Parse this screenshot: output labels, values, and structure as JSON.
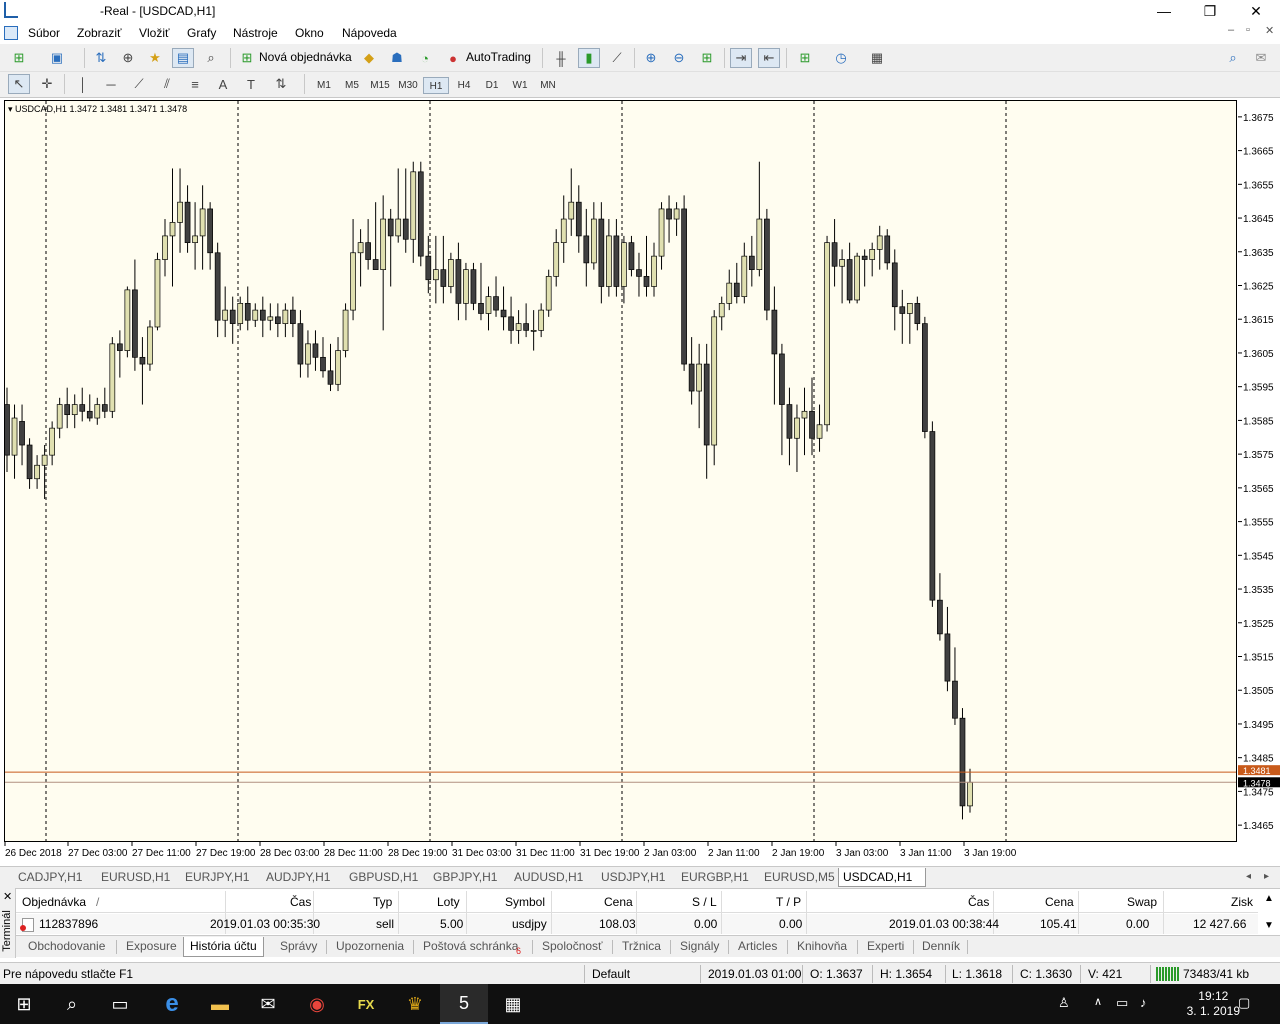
{
  "window": {
    "title": "-Real - [USDCAD,H1]",
    "minimize": "—",
    "maximize": "❐",
    "close": "✕"
  },
  "menu": [
    "Súbor",
    "Zobraziť",
    "Vložiť",
    "Grafy",
    "Nástroje",
    "Okno",
    "Nápoveda"
  ],
  "mdi": {
    "min": "–",
    "restore": "▫",
    "close": "✕"
  },
  "toolbar": {
    "new_order": "Nová objednávka",
    "autotrading": "AutoTrading"
  },
  "timeframes": [
    "M1",
    "M5",
    "M15",
    "M30",
    "H1",
    "H4",
    "D1",
    "W1",
    "MN"
  ],
  "active_timeframe": "H1",
  "chart": {
    "label": "USDCAD,H1  1.3472 1.3481 1.3471 1.3478",
    "bid_tag": "1.3481",
    "last_tag": "1.3478",
    "bg": "#fffdf0",
    "bull_color": "#e0e0b0",
    "bear_color": "#404040"
  },
  "chart_data": {
    "type": "candlestick",
    "symbol": "USDCAD",
    "timeframe": "H1",
    "ylim": [
      1.346,
      1.368
    ],
    "y_ticks": [
      "1.3675",
      "1.3665",
      "1.3655",
      "1.3645",
      "1.3635",
      "1.3625",
      "1.3615",
      "1.3605",
      "1.3595",
      "1.3585",
      "1.3575",
      "1.3565",
      "1.3555",
      "1.3545",
      "1.3535",
      "1.3525",
      "1.3515",
      "1.3505",
      "1.3495",
      "1.3485",
      "1.3475",
      "1.3465"
    ],
    "x_ticks": [
      "26 Dec 2018",
      "27 Dec 03:00",
      "27 Dec 11:00",
      "27 Dec 19:00",
      "28 Dec 03:00",
      "28 Dec 11:00",
      "28 Dec 19:00",
      "31 Dec 03:00",
      "31 Dec 11:00",
      "31 Dec 19:00",
      "2 Jan 03:00",
      "2 Jan 11:00",
      "2 Jan 19:00",
      "3 Jan 03:00",
      "3 Jan 11:00",
      "3 Jan 19:00"
    ],
    "ohlc": [
      [
        1.359,
        1.3595,
        1.357,
        1.3575
      ],
      [
        1.3575,
        1.359,
        1.3568,
        1.3586
      ],
      [
        1.3585,
        1.359,
        1.3572,
        1.3578
      ],
      [
        1.3578,
        1.358,
        1.3565,
        1.3568
      ],
      [
        1.3568,
        1.3575,
        1.3565,
        1.3572
      ],
      [
        1.3572,
        1.3578,
        1.3562,
        1.3575
      ],
      [
        1.3575,
        1.3585,
        1.3572,
        1.3583
      ],
      [
        1.3583,
        1.3592,
        1.358,
        1.359
      ],
      [
        1.359,
        1.3595,
        1.3583,
        1.3587
      ],
      [
        1.3587,
        1.3593,
        1.3583,
        1.359
      ],
      [
        1.359,
        1.3595,
        1.3585,
        1.3588
      ],
      [
        1.3588,
        1.3593,
        1.3585,
        1.3586
      ],
      [
        1.3586,
        1.3592,
        1.3584,
        1.359
      ],
      [
        1.359,
        1.3595,
        1.3586,
        1.3588
      ],
      [
        1.3588,
        1.361,
        1.3586,
        1.3608
      ],
      [
        1.3608,
        1.3612,
        1.3598,
        1.3606
      ],
      [
        1.3606,
        1.3625,
        1.3604,
        1.3624
      ],
      [
        1.3624,
        1.3633,
        1.36,
        1.3604
      ],
      [
        1.3604,
        1.361,
        1.359,
        1.3602
      ],
      [
        1.3602,
        1.3615,
        1.36,
        1.3613
      ],
      [
        1.3613,
        1.3635,
        1.3612,
        1.3633
      ],
      [
        1.3633,
        1.3645,
        1.3628,
        1.364
      ],
      [
        1.364,
        1.366,
        1.3625,
        1.3644
      ],
      [
        1.3644,
        1.366,
        1.3635,
        1.365
      ],
      [
        1.365,
        1.3655,
        1.3635,
        1.3638
      ],
      [
        1.3638,
        1.365,
        1.363,
        1.364
      ],
      [
        1.364,
        1.3655,
        1.363,
        1.3648
      ],
      [
        1.3648,
        1.365,
        1.363,
        1.3635
      ],
      [
        1.3635,
        1.3638,
        1.361,
        1.3615
      ],
      [
        1.3615,
        1.3625,
        1.361,
        1.3618
      ],
      [
        1.3618,
        1.3622,
        1.3608,
        1.3614
      ],
      [
        1.3614,
        1.3622,
        1.3612,
        1.362
      ],
      [
        1.362,
        1.3625,
        1.3612,
        1.3615
      ],
      [
        1.3615,
        1.362,
        1.3613,
        1.3618
      ],
      [
        1.3618,
        1.3622,
        1.361,
        1.3615
      ],
      [
        1.3615,
        1.362,
        1.3612,
        1.3616
      ],
      [
        1.3616,
        1.362,
        1.361,
        1.3614
      ],
      [
        1.3614,
        1.362,
        1.361,
        1.3618
      ],
      [
        1.3618,
        1.3622,
        1.361,
        1.3614
      ],
      [
        1.3614,
        1.3618,
        1.3598,
        1.3602
      ],
      [
        1.3602,
        1.3612,
        1.3598,
        1.3608
      ],
      [
        1.3608,
        1.3612,
        1.36,
        1.3604
      ],
      [
        1.3604,
        1.361,
        1.3598,
        1.36
      ],
      [
        1.36,
        1.3608,
        1.3594,
        1.3596
      ],
      [
        1.3596,
        1.361,
        1.3594,
        1.3606
      ],
      [
        1.3606,
        1.362,
        1.3604,
        1.3618
      ],
      [
        1.3618,
        1.3645,
        1.3615,
        1.3635
      ],
      [
        1.3635,
        1.3642,
        1.3625,
        1.3638
      ],
      [
        1.3638,
        1.3645,
        1.363,
        1.3633
      ],
      [
        1.3633,
        1.365,
        1.363,
        1.363
      ],
      [
        1.363,
        1.3652,
        1.3612,
        1.3645
      ],
      [
        1.3645,
        1.3648,
        1.3625,
        1.364
      ],
      [
        1.364,
        1.366,
        1.3638,
        1.3645
      ],
      [
        1.3645,
        1.366,
        1.3635,
        1.3639
      ],
      [
        1.3639,
        1.3662,
        1.3632,
        1.3659
      ],
      [
        1.3659,
        1.3662,
        1.3631,
        1.3634
      ],
      [
        1.3634,
        1.364,
        1.3623,
        1.3627
      ],
      [
        1.3627,
        1.364,
        1.362,
        1.363
      ],
      [
        1.363,
        1.364,
        1.362,
        1.3625
      ],
      [
        1.3625,
        1.3635,
        1.3623,
        1.3633
      ],
      [
        1.3633,
        1.3638,
        1.3615,
        1.362
      ],
      [
        1.362,
        1.3632,
        1.3615,
        1.363
      ],
      [
        1.363,
        1.3632,
        1.3618,
        1.362
      ],
      [
        1.362,
        1.3632,
        1.3615,
        1.3617
      ],
      [
        1.3617,
        1.3625,
        1.3612,
        1.3622
      ],
      [
        1.3622,
        1.3628,
        1.3616,
        1.3618
      ],
      [
        1.3618,
        1.3625,
        1.3612,
        1.3616
      ],
      [
        1.3616,
        1.3622,
        1.3608,
        1.3612
      ],
      [
        1.3612,
        1.3618,
        1.3608,
        1.3614
      ],
      [
        1.3614,
        1.362,
        1.361,
        1.3612
      ],
      [
        1.3612,
        1.3618,
        1.3606,
        1.3612
      ],
      [
        1.3612,
        1.362,
        1.361,
        1.3618
      ],
      [
        1.3618,
        1.363,
        1.3616,
        1.3628
      ],
      [
        1.3628,
        1.3642,
        1.3625,
        1.3638
      ],
      [
        1.3638,
        1.3652,
        1.3632,
        1.3645
      ],
      [
        1.3645,
        1.366,
        1.364,
        1.365
      ],
      [
        1.365,
        1.3655,
        1.3635,
        1.364
      ],
      [
        1.364,
        1.3648,
        1.3625,
        1.3632
      ],
      [
        1.3632,
        1.365,
        1.363,
        1.3645
      ],
      [
        1.3645,
        1.365,
        1.362,
        1.3625
      ],
      [
        1.3625,
        1.3645,
        1.3622,
        1.364
      ],
      [
        1.364,
        1.3645,
        1.3622,
        1.3625
      ],
      [
        1.3625,
        1.364,
        1.362,
        1.3638
      ],
      [
        1.3638,
        1.364,
        1.3628,
        1.363
      ],
      [
        1.363,
        1.3635,
        1.3622,
        1.3628
      ],
      [
        1.3628,
        1.364,
        1.3622,
        1.3625
      ],
      [
        1.3625,
        1.3638,
        1.3622,
        1.3634
      ],
      [
        1.3634,
        1.365,
        1.363,
        1.3648
      ],
      [
        1.3648,
        1.3652,
        1.3638,
        1.3645
      ],
      [
        1.3645,
        1.365,
        1.364,
        1.3648
      ],
      [
        1.3648,
        1.3652,
        1.36,
        1.3602
      ],
      [
        1.3602,
        1.361,
        1.359,
        1.3594
      ],
      [
        1.3594,
        1.3608,
        1.3583,
        1.3602
      ],
      [
        1.3602,
        1.3608,
        1.3568,
        1.3578
      ],
      [
        1.3578,
        1.3618,
        1.3572,
        1.3616
      ],
      [
        1.3616,
        1.3622,
        1.3612,
        1.362
      ],
      [
        1.362,
        1.363,
        1.3618,
        1.3626
      ],
      [
        1.3626,
        1.3632,
        1.362,
        1.3622
      ],
      [
        1.3622,
        1.3638,
        1.362,
        1.3634
      ],
      [
        1.3634,
        1.364,
        1.3625,
        1.363
      ],
      [
        1.363,
        1.3662,
        1.3628,
        1.3645
      ],
      [
        1.3645,
        1.3648,
        1.3615,
        1.3618
      ],
      [
        1.3618,
        1.3625,
        1.359,
        1.3605
      ],
      [
        1.3605,
        1.3608,
        1.3575,
        1.359
      ],
      [
        1.359,
        1.3595,
        1.3572,
        1.358
      ],
      [
        1.358,
        1.359,
        1.357,
        1.3586
      ],
      [
        1.3586,
        1.3595,
        1.3575,
        1.3588
      ],
      [
        1.3588,
        1.3598,
        1.3575,
        1.358
      ],
      [
        1.358,
        1.359,
        1.3576,
        1.3584
      ],
      [
        1.3584,
        1.364,
        1.3582,
        1.3638
      ],
      [
        1.3638,
        1.3645,
        1.3625,
        1.3631
      ],
      [
        1.3631,
        1.3636,
        1.362,
        1.3633
      ],
      [
        1.3633,
        1.3638,
        1.362,
        1.3621
      ],
      [
        1.3621,
        1.3635,
        1.362,
        1.3634
      ],
      [
        1.3634,
        1.3636,
        1.3625,
        1.3633
      ],
      [
        1.3633,
        1.3638,
        1.3628,
        1.3636
      ],
      [
        1.3636,
        1.3643,
        1.363,
        1.364
      ],
      [
        1.364,
        1.3642,
        1.363,
        1.3632
      ],
      [
        1.3632,
        1.3636,
        1.3612,
        1.3619
      ],
      [
        1.3619,
        1.3624,
        1.3608,
        1.3617
      ],
      [
        1.3617,
        1.362,
        1.3608,
        1.362
      ],
      [
        1.362,
        1.3622,
        1.3612,
        1.3614
      ],
      [
        1.3614,
        1.3616,
        1.358,
        1.3582
      ],
      [
        1.3582,
        1.3585,
        1.353,
        1.3532
      ],
      [
        1.3532,
        1.354,
        1.352,
        1.3522
      ],
      [
        1.3522,
        1.353,
        1.3505,
        1.3508
      ],
      [
        1.3508,
        1.3518,
        1.3495,
        1.3497
      ],
      [
        1.3497,
        1.35,
        1.3467,
        1.3471
      ],
      [
        1.3471,
        1.3482,
        1.3469,
        1.3478
      ]
    ]
  },
  "chart_tabs": [
    "CADJPY,H1",
    "EURUSD,H1",
    "EURJPY,H1",
    "AUDJPY,H1",
    "GBPUSD,H1",
    "GBPJPY,H1",
    "AUDUSD,H1",
    "USDJPY,H1",
    "EURGBP,H1",
    "EURUSD,M5",
    "USDCAD,H1"
  ],
  "active_chart_tab": "USDCAD,H1",
  "terminal": {
    "side_label": "Terminál",
    "columns": [
      "Objednávka",
      "Čas",
      "Typ",
      "Loty",
      "Symbol",
      "Cena",
      "S / L",
      "T / P",
      "Čas",
      "Cena",
      "Swap",
      "Zisk"
    ],
    "sort_arrow": "/",
    "rows": [
      {
        "order": "112837896",
        "open_time": "2019.01.03 00:35:30",
        "type": "sell",
        "lots": "5.00",
        "symbol": "usdjpy",
        "price": "108.03",
        "sl": "0.00",
        "tp": "0.00",
        "close_time": "2019.01.03 00:38:44",
        "close_price": "105.41",
        "swap": "0.00",
        "profit": "12 427.66"
      }
    ],
    "tabs": [
      "Obchodovanie",
      "Exposure",
      "História účtu",
      "Správy",
      "Upozornenia",
      "Poštová schránka",
      "Spoločnosť",
      "Tržnica",
      "Signály",
      "Articles",
      "Knihovňa",
      "Experti",
      "Denník"
    ],
    "active_tab": "História účtu",
    "mail_badge": "6"
  },
  "status": {
    "help": "Pre nápovedu stlačte F1",
    "profile": "Default",
    "datetime": "2019.01.03 01:00",
    "open": "O: 1.3637",
    "high": "H: 1.3654",
    "low": "L: 1.3618",
    "close": "C: 1.3630",
    "volume": "V: 421",
    "traffic": "73483/41 kb"
  },
  "taskbar": {
    "time": "19:12",
    "date": "3. 1. 2019"
  }
}
